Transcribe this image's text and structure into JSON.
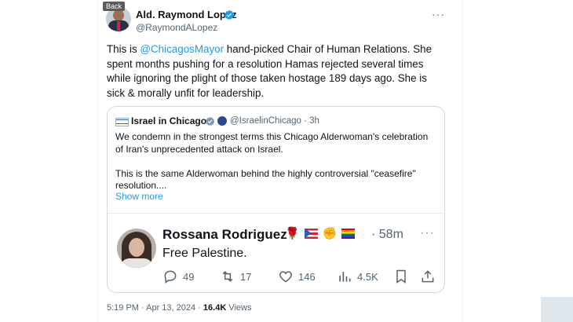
{
  "tooltip": "Back",
  "author": {
    "name": "Ald. Raymond Lopez",
    "handle": "@RaymondALopez"
  },
  "more_label": "···",
  "tweet": {
    "part1": "This is ",
    "mention": "@ChicagosMayor",
    "part2": " hand-picked Chair of Human Relations. She spent months pushing for a resolution Hamas rejected several times while ignoring the plight of those taken hostage 189 days ago. She is sick & morally unfit for leadership."
  },
  "quote": {
    "name": "Israel in Chicago",
    "handle_time": "@IsraelinChicago · 3h",
    "paragraph1": "We condemn in the strongest terms this Chicago Alderwoman's celebration of Iran's unprecedented attack on Israel.",
    "paragraph2": "This is the same Alderwoman behind the highly controversial \"ceasefire\" resolution....",
    "show_more": "Show more"
  },
  "embedded": {
    "name": "Rossana Rodriguez",
    "time": "· 58m",
    "text": "Free Palestine.",
    "more_label": "···",
    "actions": {
      "replies": "49",
      "reposts": "17",
      "likes": "146",
      "views": "4.5K"
    },
    "icons": [
      "reply-icon",
      "repost-icon",
      "like-icon",
      "views-icon",
      "bookmark-icon",
      "share-icon"
    ]
  },
  "footer": {
    "timestamp": "5:19 PM · Apr 13, 2024 · ",
    "views_count": "16.4K",
    "views_label": " Views"
  },
  "colors": {
    "accent": "#1d9bf0",
    "text": "#0f1419",
    "muted": "#536471",
    "border": "#cfd9de"
  }
}
